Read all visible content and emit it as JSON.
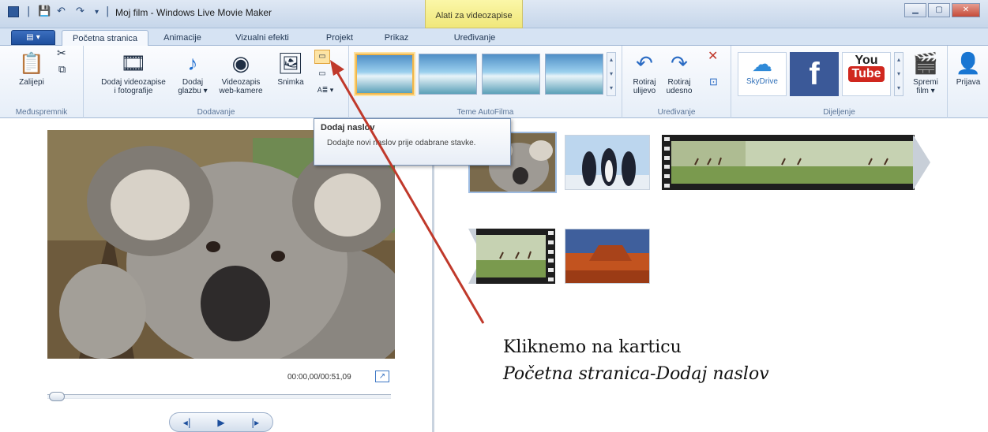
{
  "window": {
    "title": "Moj film - Windows Live Movie Maker",
    "context_tab": "Alati za videozapise",
    "controls": [
      "▁",
      "▢",
      "✕"
    ]
  },
  "tabs": [
    "Početna stranica",
    "Animacije",
    "Vizualni efekti",
    "Projekt",
    "Prikaz",
    "Uređivanje"
  ],
  "ribbon": {
    "clipboard": {
      "label": "Međuspremnik",
      "paste": "Zalijepi"
    },
    "add": {
      "label": "Dodavanje",
      "add_videos_line1": "Dodaj videozapise",
      "add_videos_line2": "i fotografije",
      "add_music_line1": "Dodaj",
      "add_music_line2": "glazbu ▾",
      "webcam_line1": "Videozapis",
      "webcam_line2": "web-kamere",
      "snapshot": "Snimka"
    },
    "themes": {
      "label": "Teme AutoFilma"
    },
    "editing": {
      "label": "Uređivanje",
      "rotate_left_line1": "Rotiraj",
      "rotate_left_line2": "ulijevo",
      "rotate_right_line1": "Rotiraj",
      "rotate_right_line2": "udesno"
    },
    "sharing": {
      "label": "Dijeljenje",
      "skydrive": "SkyDrive",
      "facebook": "f",
      "youtube_top": "You",
      "youtube_bottom": "Tube",
      "save_line1": "Spremi",
      "save_line2": "film ▾"
    },
    "signin": "Prijava"
  },
  "tooltip": {
    "title": "Dodaj naslov",
    "body": "Dodajte novi naslov prije odabrane stavke."
  },
  "preview": {
    "time": "00:00,00/00:51,09",
    "progress": 0
  },
  "caption": {
    "line1": "Kliknemo na karticu",
    "line2": "Početna stranica-Dodaj naslov"
  },
  "colors": {
    "accent": "#1e4f9e",
    "arrow": "#c0392b",
    "context_tab": "#f0e77a"
  }
}
